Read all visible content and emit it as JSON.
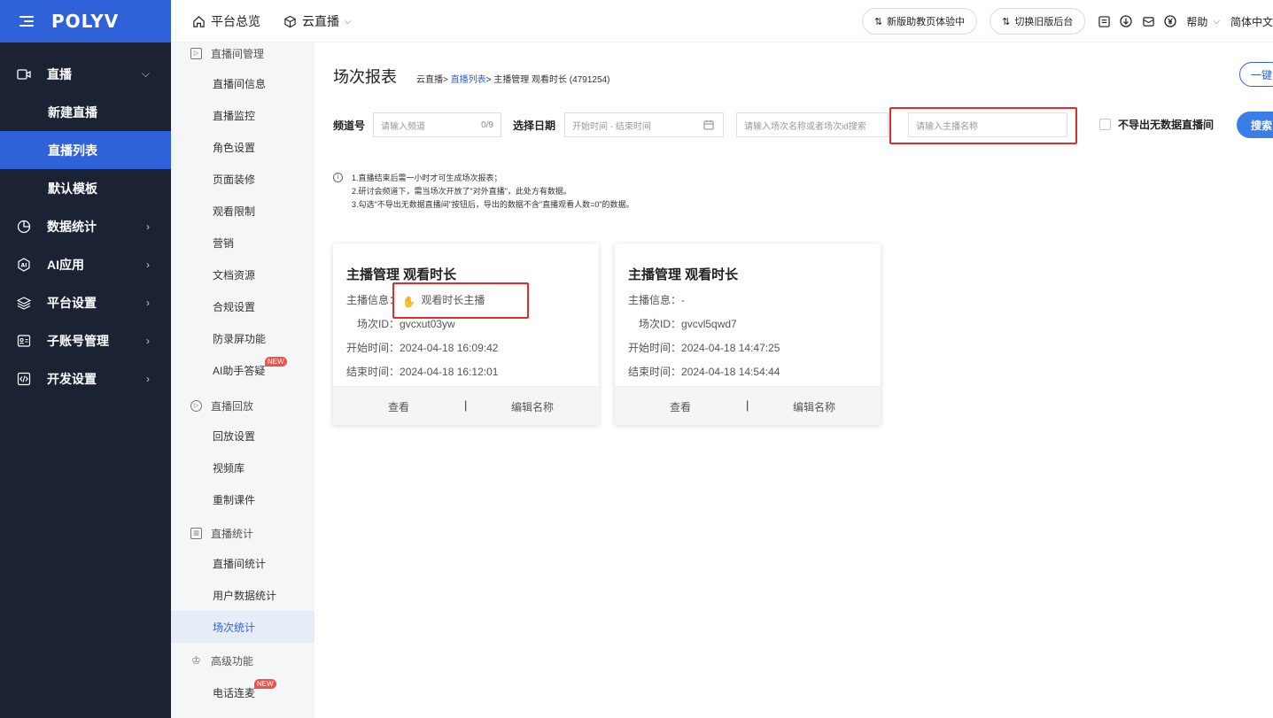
{
  "brand": {
    "logo": "POLYV",
    "color": "#2f62d8"
  },
  "topnav": {
    "overview": "平台总览",
    "cloud_live": "云直播"
  },
  "topright": {
    "new_version": "新版助教页体验中",
    "switch_old": "切换旧版后台",
    "help": "帮助",
    "language": "简体中文",
    "icons": [
      "document-icon",
      "download-icon",
      "mail-icon",
      "yen-icon"
    ]
  },
  "sidebar": {
    "items": [
      {
        "label": "直播",
        "icon": "video-icon",
        "expanded": true
      },
      {
        "label": "新建直播",
        "sub": true
      },
      {
        "label": "直播列表",
        "sub": true,
        "active": true
      },
      {
        "label": "默认模板",
        "sub": true
      },
      {
        "label": "数据统计",
        "icon": "chart-icon"
      },
      {
        "label": "AI应用",
        "icon": "ai-icon"
      },
      {
        "label": "平台设置",
        "icon": "layers-icon"
      },
      {
        "label": "子账号管理",
        "icon": "account-icon"
      },
      {
        "label": "开发设置",
        "icon": "code-icon"
      }
    ]
  },
  "submenu": {
    "groups": [
      {
        "title": "直播间管理",
        "items": [
          "直播间信息",
          "直播监控",
          "角色设置",
          "页面装修",
          "观看限制",
          "营销",
          "文档资源",
          "合规设置",
          "防录屏功能",
          "AI助手答疑"
        ]
      },
      {
        "title": "直播回放",
        "items": [
          "回放设置",
          "视频库",
          "重制课件"
        ]
      },
      {
        "title": "直播统计",
        "items": [
          "直播间统计",
          "用户数据统计",
          "场次统计"
        ]
      },
      {
        "title": "高级功能",
        "items": [
          "电话连麦"
        ]
      }
    ],
    "new_badge": "NEW"
  },
  "main": {
    "title": "场次报表",
    "breadcrumb": {
      "root": "云直播",
      "sep": ">",
      "list": "直播列表",
      "current": "主播管理 观看时长 (4791254)"
    },
    "one_button": "一键",
    "filters": {
      "channel_label": "频道号",
      "channel_placeholder": "请输入频道",
      "channel_count": "0/9",
      "date_label": "选择日期",
      "date_placeholder": "开始时间 - 结束时间",
      "session_placeholder": "请输入场次名称或者场次id搜索",
      "anchor_placeholder": "请输入主播名称",
      "no_data_checkbox": "不导出无数据直播间",
      "search": "搜索"
    },
    "tips": [
      "1.直播结束后需一小时才可生成场次报表；",
      "2.研讨会频道下，需当场次开放了\"对外直播\"，此处方有数据。",
      "3.勾选\"不导出无数据直播间\"按钮后，导出的数据不含\"直播观看人数=0\"的数据。"
    ],
    "cards": [
      {
        "title": "主播管理 观看时长",
        "anchor_label": "主播信息：",
        "anchor_value": "观看时长主播",
        "session_label": "场次ID：",
        "session_value": "gvcxut03yw",
        "start_label": "开始时间：",
        "start_value": "2024-04-18 16:09:42",
        "end_label": "结束时间：",
        "end_value": "2024-04-18 16:12:01",
        "view": "查看",
        "divider": "|",
        "edit": "编辑名称"
      },
      {
        "title": "主播管理 观看时长",
        "anchor_label": "主播信息：",
        "anchor_value": "-",
        "session_label": "场次ID：",
        "session_value": "gvcvl5qwd7",
        "start_label": "开始时间：",
        "start_value": "2024-04-18 14:47:25",
        "end_label": "结束时间：",
        "end_value": "2024-04-18 14:54:44",
        "view": "查看",
        "divider": "|",
        "edit": "编辑名称"
      }
    ]
  }
}
